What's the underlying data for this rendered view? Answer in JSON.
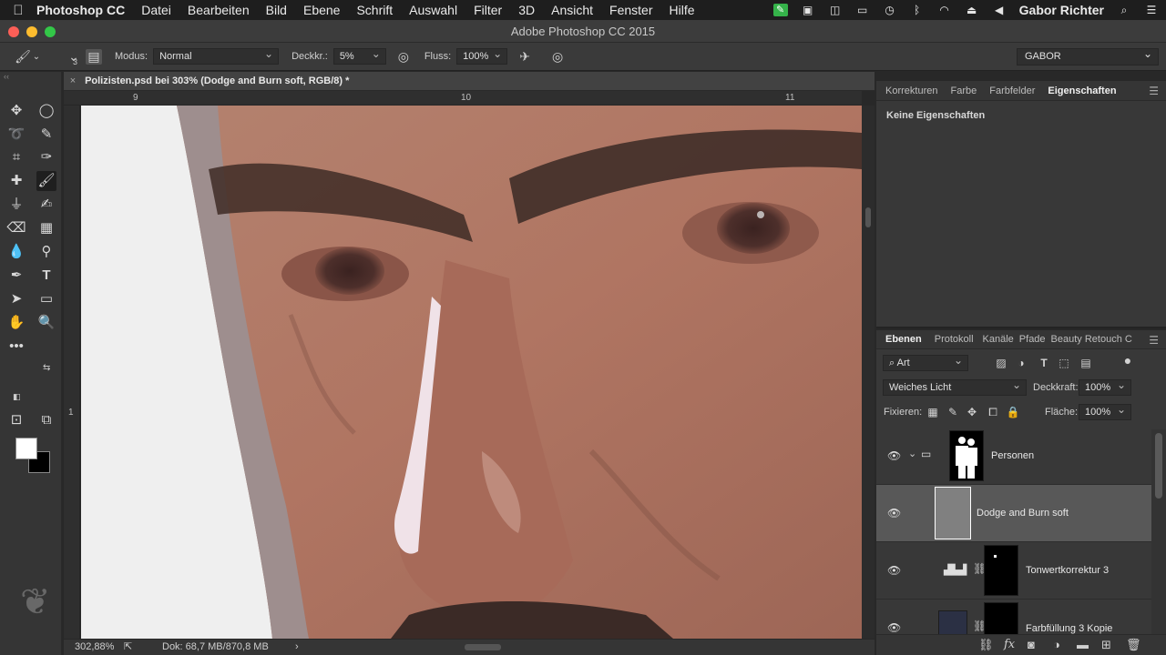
{
  "menubar": {
    "app_name": "Photoshop CC",
    "items": [
      "Datei",
      "Bearbeiten",
      "Bild",
      "Ebene",
      "Schrift",
      "Auswahl",
      "Filter",
      "3D",
      "Ansicht",
      "Fenster",
      "Hilfe"
    ],
    "user": "Gabor Richter"
  },
  "window": {
    "title": "Adobe Photoshop CC 2015"
  },
  "options": {
    "brush_size": "3",
    "mode_label": "Modus:",
    "mode_value": "Normal",
    "opacity_label": "Deckkr.:",
    "opacity_value": "5%",
    "flow_label": "Fluss:",
    "flow_value": "100%",
    "workspace": "GABOR"
  },
  "document": {
    "tab_title": "Polizisten.psd bei 303% (Dodge and Burn soft, RGB/8) *",
    "ruler_h": [
      "9",
      "10",
      "11"
    ],
    "ruler_v": [
      "1"
    ],
    "zoom": "302,88%",
    "doc_info": "Dok: 68,7 MB/870,8 MB"
  },
  "properties_panel": {
    "tabs": [
      "Korrekturen",
      "Farbe",
      "Farbfelder",
      "Eigenschaften"
    ],
    "active_tab": "Eigenschaften",
    "info": "Keine Eigenschaften"
  },
  "layers_panel": {
    "tabs": [
      "Ebenen",
      "Protokoll",
      "Kanäle",
      "Pfade",
      "Beauty Retouch C"
    ],
    "active_tab": "Ebenen",
    "filter_kind": "Art",
    "blend_mode": "Weiches Licht",
    "opacity_label": "Deckkraft:",
    "opacity_value": "100%",
    "lock_label": "Fixieren:",
    "fill_label": "Fläche:",
    "fill_value": "100%",
    "layers": [
      {
        "name": "Personen"
      },
      {
        "name": "Dodge and Burn soft"
      },
      {
        "name": "Tonwertkorrektur 3"
      },
      {
        "name": "Farbfüllung 3 Kopie"
      }
    ]
  },
  "colors": {
    "accent_green": "#35b34a",
    "foreground": "#ffffff",
    "background": "#000000"
  }
}
